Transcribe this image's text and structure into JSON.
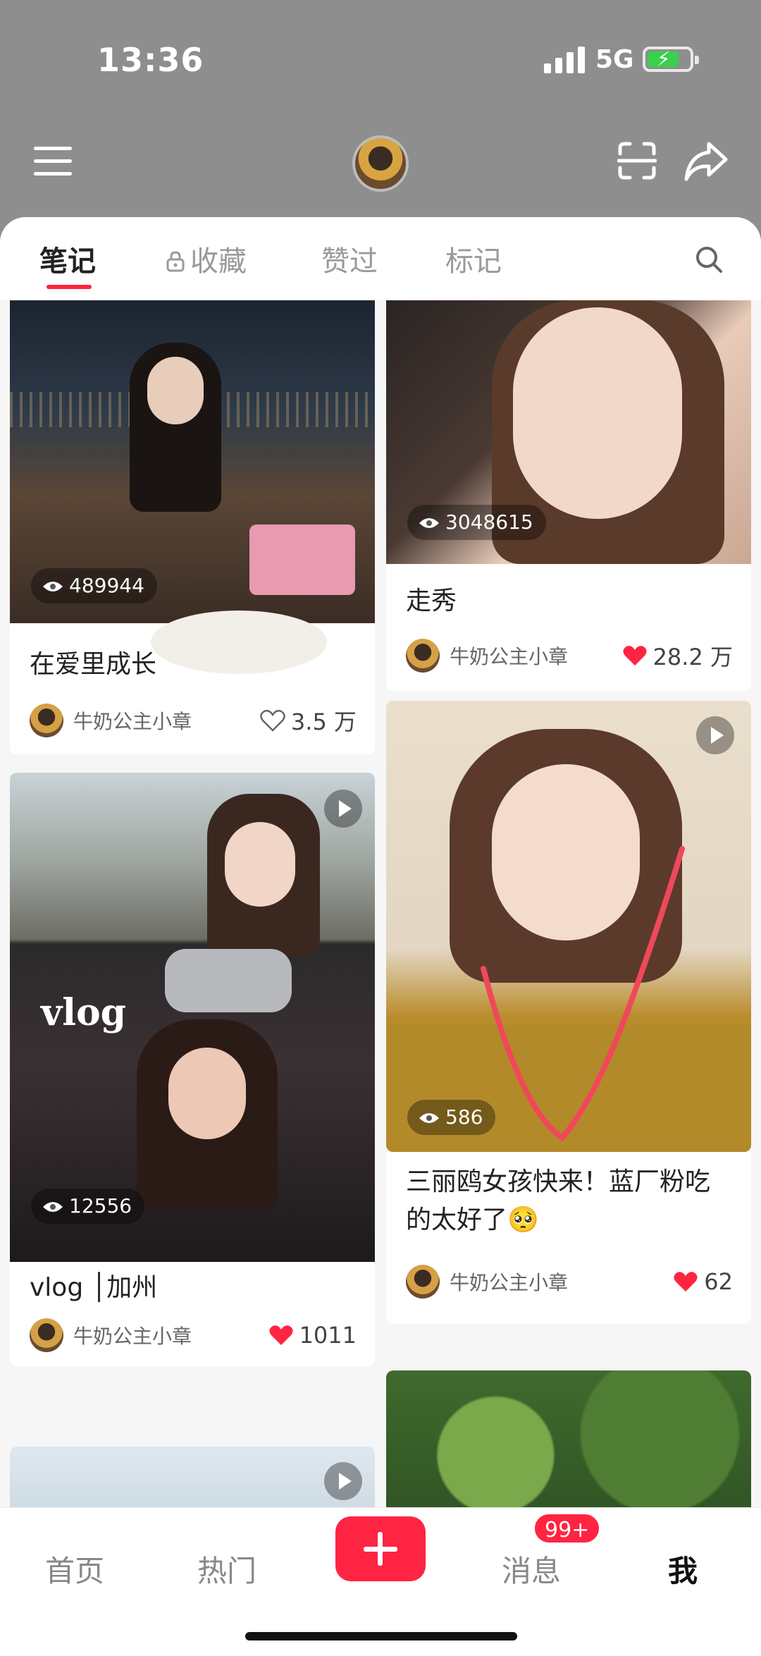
{
  "status_bar": {
    "time": "13:36",
    "network": "5G"
  },
  "header": {
    "avatar": "user-avatar"
  },
  "tabs": [
    {
      "label": "笔记",
      "active": true
    },
    {
      "label": "收藏",
      "active": false,
      "icon": "lock-icon"
    },
    {
      "label": "赞过",
      "active": false
    },
    {
      "label": "标记",
      "active": false
    }
  ],
  "cards": {
    "left": [
      {
        "views": "489944",
        "title": "在爱里成长",
        "author": "牛奶公主小章",
        "likes": "3.5 万",
        "liked": false
      },
      {
        "views": "12556",
        "title": "vlog │加州",
        "author": "牛奶公主小章",
        "likes": "1011",
        "liked": true,
        "overlay_text": "vlog",
        "video": true
      }
    ],
    "right": [
      {
        "views": "3048615",
        "title": "走秀",
        "author": "牛奶公主小章",
        "likes": "28.2 万",
        "liked": true
      },
      {
        "views": "586",
        "title": "三丽鸥女孩快来！蓝厂粉吃的太好了🥺",
        "author": "牛奶公主小章",
        "likes": "62",
        "liked": true,
        "video": true
      }
    ]
  },
  "bottom_nav": {
    "items": [
      {
        "label": "首页",
        "active": false
      },
      {
        "label": "热门",
        "active": false
      },
      {
        "label": "消息",
        "active": false,
        "badge": "99+"
      },
      {
        "label": "我",
        "active": true
      }
    ]
  },
  "colors": {
    "accent": "#ff2442",
    "background": "#f6f6f6"
  }
}
